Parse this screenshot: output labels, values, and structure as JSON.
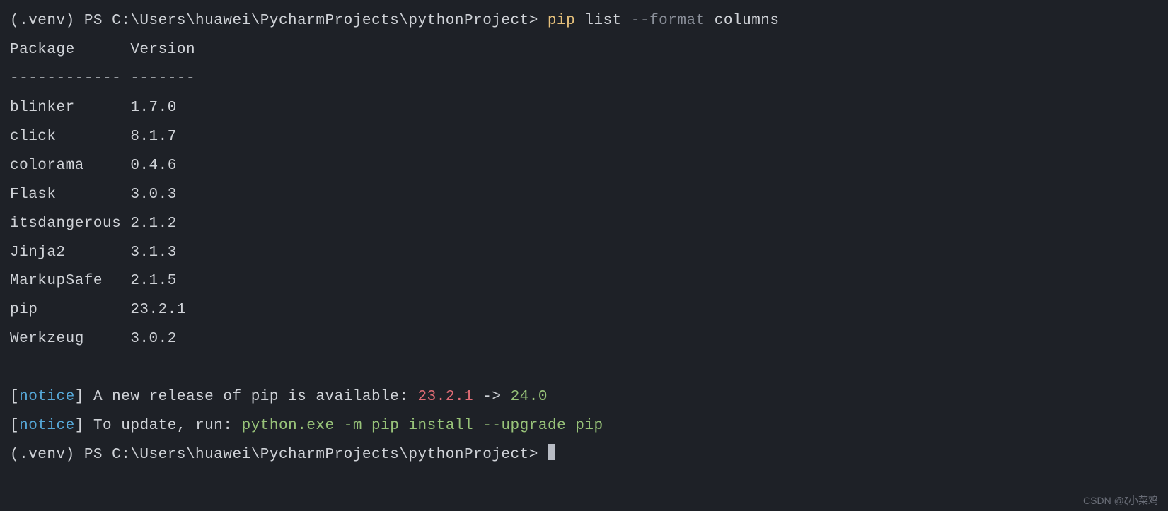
{
  "prompt1": {
    "prefix": "(.venv) PS C:\\Users\\huawei\\PycharmProjects\\pythonProject> ",
    "cmd_pip": "pip",
    "cmd_list": " list ",
    "cmd_flag": "--format",
    "cmd_arg": " columns"
  },
  "table": {
    "header_package": "Package",
    "header_version": "Version",
    "dash_package": "------------",
    "dash_version": "-------",
    "rows": [
      {
        "pkg": "blinker",
        "ver": "1.7.0"
      },
      {
        "pkg": "click",
        "ver": "8.1.7"
      },
      {
        "pkg": "colorama",
        "ver": "0.4.6"
      },
      {
        "pkg": "Flask",
        "ver": "3.0.3"
      },
      {
        "pkg": "itsdangerous",
        "ver": "2.1.2"
      },
      {
        "pkg": "Jinja2",
        "ver": "3.1.3"
      },
      {
        "pkg": "MarkupSafe",
        "ver": "2.1.5"
      },
      {
        "pkg": "pip",
        "ver": "23.2.1"
      },
      {
        "pkg": "Werkzeug",
        "ver": "3.0.2"
      }
    ]
  },
  "notice1": {
    "open": "[",
    "label": "notice",
    "close": "] ",
    "msg1": "A new release of pip is available: ",
    "old": "23.2.1",
    "arrow": " -> ",
    "new": "24.0"
  },
  "notice2": {
    "open": "[",
    "label": "notice",
    "close": "] ",
    "msg1": "To update, run: ",
    "cmd": "python.exe -m pip install --upgrade pip"
  },
  "prompt2": {
    "prefix": "(.venv) PS C:\\Users\\huawei\\PycharmProjects\\pythonProject> "
  },
  "watermark": "CSDN @ζ小菜鸡"
}
